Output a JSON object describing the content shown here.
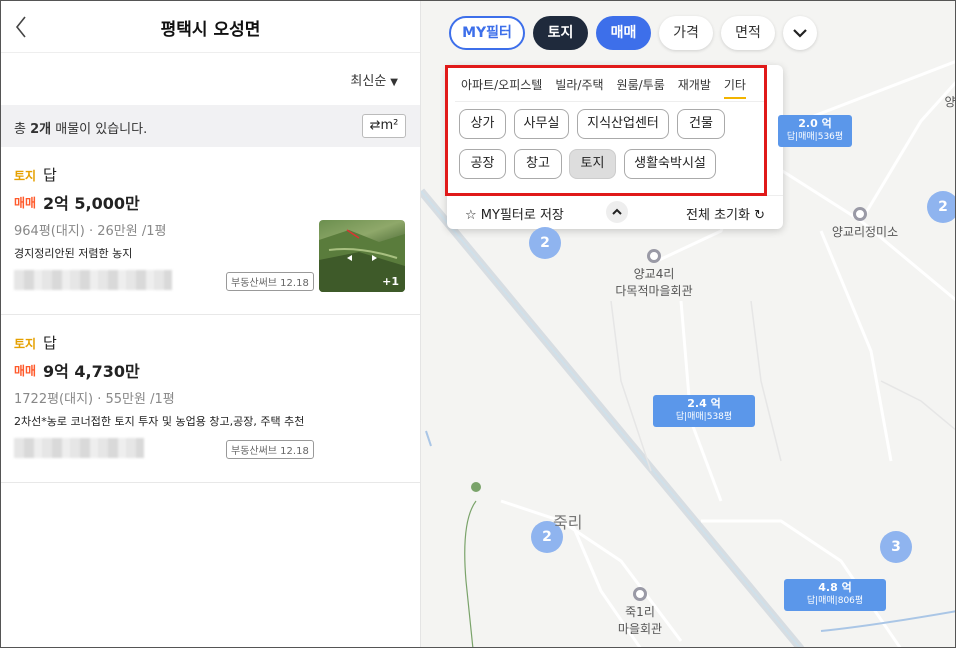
{
  "header": {
    "title": "평택시 오성면",
    "back_icon": "chevron-left-icon"
  },
  "sort": {
    "label": "최신순",
    "caret": "▼"
  },
  "summary": {
    "prefix": "총 ",
    "count": "2개",
    "suffix": " 매물이 있습니다.",
    "unit_toggle": "⇄m²"
  },
  "listings": [
    {
      "type": "토지",
      "subtype": "답",
      "deal": "매매",
      "price": "2억 5,000만",
      "info": "964평(대지) · 26만원 /1평",
      "desc": "경지정리안된 저렴한 농지",
      "badge": "부동산써브 12.18",
      "photo_extra": "+1"
    },
    {
      "type": "토지",
      "subtype": "답",
      "deal": "매매",
      "price": "9억 4,730만",
      "info": "1722평(대지) · 55만원 /1평",
      "desc": "2차선*농로 코너접한 토지 투자 및 농업용 창고,공장, 주택 추천",
      "badge": "부동산써브 12.18"
    }
  ],
  "filters": {
    "my_filter": "MY필터",
    "land": "토지",
    "deal": "매매",
    "price": "가격",
    "area": "면적"
  },
  "popup": {
    "tabs": [
      "아파트/오피스텔",
      "빌라/주택",
      "원룸/투룸",
      "재개발",
      "기타"
    ],
    "options": [
      "상가",
      "사무실",
      "지식산업센터",
      "건물",
      "공장",
      "창고",
      "토지",
      "생활숙박시설"
    ],
    "selected": "토지",
    "save_label": "MY필터로 저장",
    "reset_label": "전체 초기화"
  },
  "map": {
    "clusters": [
      "2",
      "2",
      "2",
      "3"
    ],
    "markers": [
      {
        "price": "2.0 억",
        "detail": "답|매매|536평"
      },
      {
        "price": "2.4 억",
        "detail": "답|매매|538평"
      },
      {
        "price": "4.8 억",
        "detail": "답|매매|806평"
      }
    ],
    "places": {
      "yanggyo_jeongmiso": "양교리정미소",
      "yanggyo4ri_1": "양교4리",
      "yanggyo4ri_2": "다목적마을회관",
      "jukri": "죽리",
      "juk1ri_1": "죽1리",
      "juk1ri_2": "마을회관",
      "edge": "양"
    }
  }
}
